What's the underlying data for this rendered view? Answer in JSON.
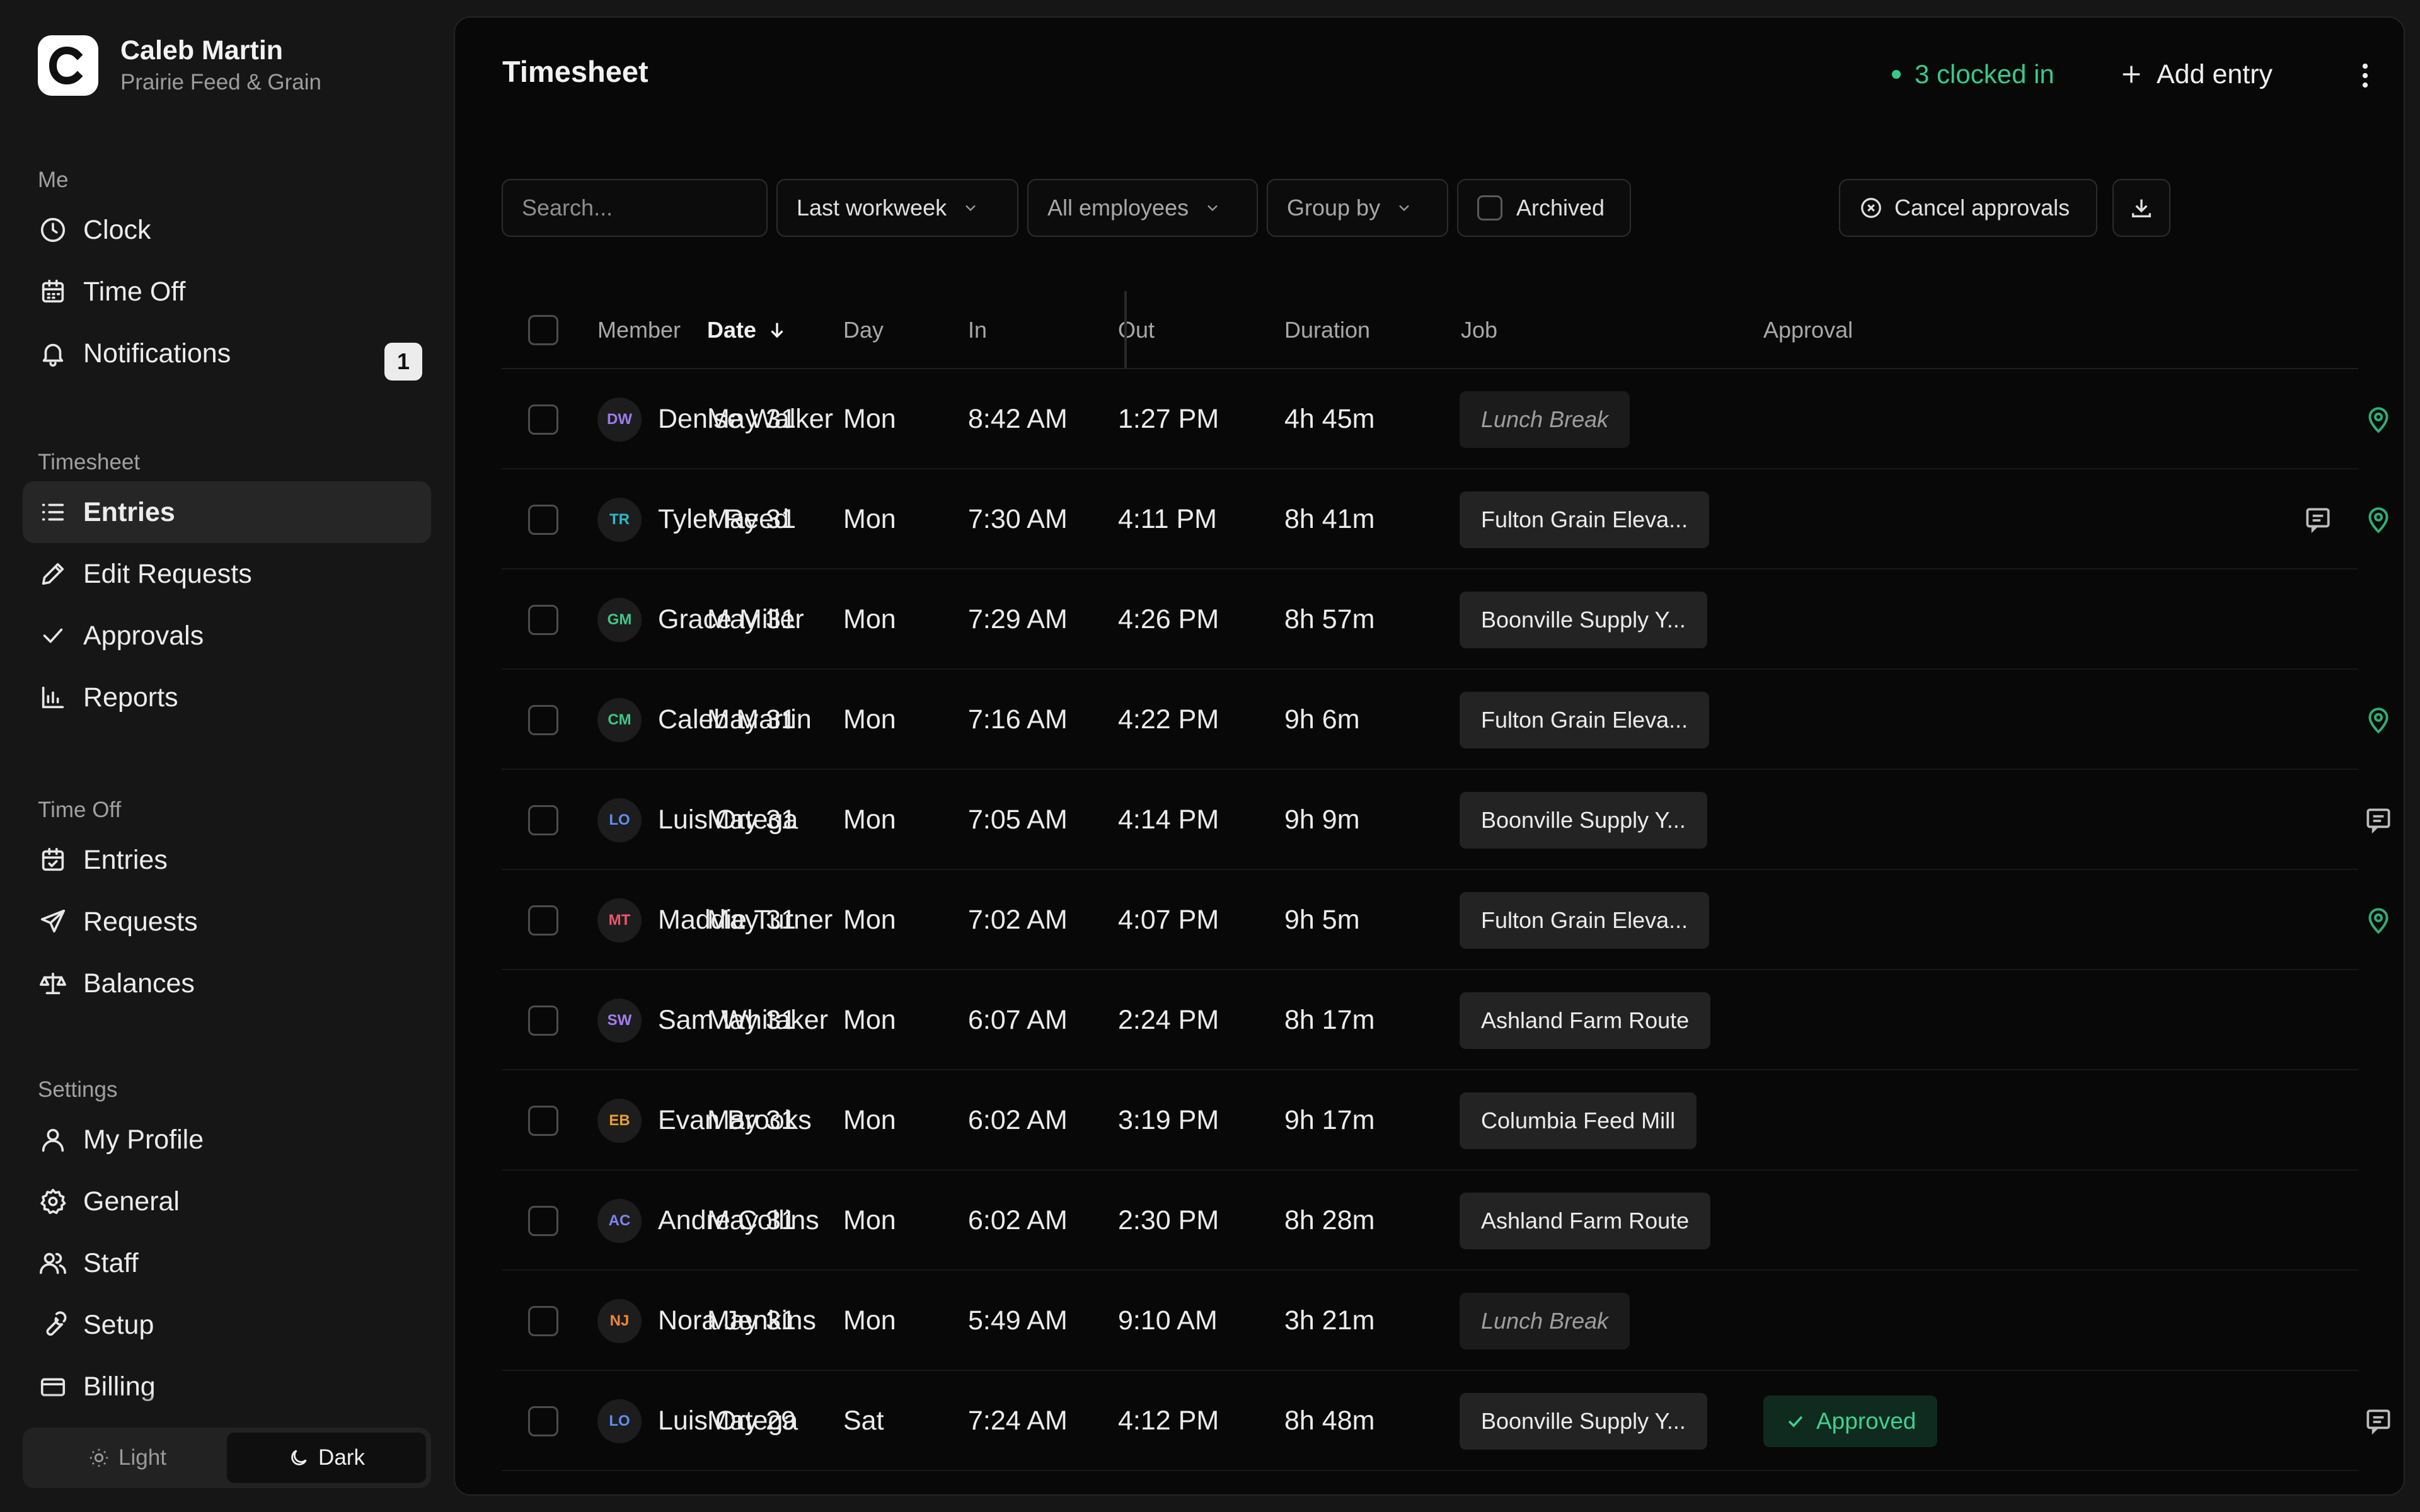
{
  "org": {
    "initial": "C",
    "name": "Caleb Martin",
    "company": "Prairie Feed & Grain"
  },
  "sidebar": {
    "sections": [
      {
        "heading": "Me",
        "items": [
          {
            "label": "Clock",
            "icon": "clock-icon"
          },
          {
            "label": "Time Off",
            "icon": "calendar-icon"
          },
          {
            "label": "Notifications",
            "icon": "bell-icon",
            "badge": "1"
          }
        ]
      },
      {
        "heading": "Timesheet",
        "items": [
          {
            "label": "Entries",
            "icon": "list-icon",
            "active": true
          },
          {
            "label": "Edit Requests",
            "icon": "pencil-icon"
          },
          {
            "label": "Approvals",
            "icon": "check-icon"
          },
          {
            "label": "Reports",
            "icon": "bar-chart-icon"
          }
        ]
      },
      {
        "heading": "Time Off",
        "items": [
          {
            "label": "Entries",
            "icon": "calendar-check-icon"
          },
          {
            "label": "Requests",
            "icon": "send-icon"
          },
          {
            "label": "Balances",
            "icon": "scale-icon"
          }
        ]
      },
      {
        "heading": "Settings",
        "items": [
          {
            "label": "My Profile",
            "icon": "user-icon"
          },
          {
            "label": "General",
            "icon": "gear-icon"
          },
          {
            "label": "Staff",
            "icon": "users-icon"
          },
          {
            "label": "Setup",
            "icon": "wrench-icon"
          },
          {
            "label": "Billing",
            "icon": "card-icon"
          }
        ]
      }
    ],
    "theme": {
      "light": "Light",
      "dark": "Dark",
      "selected": "dark"
    }
  },
  "header": {
    "title": "Timesheet",
    "clocked_in": "3 clocked in",
    "add_entry": "Add entry"
  },
  "filters": {
    "search_placeholder": "Search...",
    "range": "Last workweek",
    "employees": "All employees",
    "group_by": "Group by",
    "archived": "Archived",
    "cancel_approvals": "Cancel approvals"
  },
  "table": {
    "columns": {
      "member": "Member",
      "date": "Date",
      "day": "Day",
      "in": "In",
      "out": "Out",
      "duration": "Duration",
      "job": "Job",
      "approval": "Approval"
    },
    "rows": [
      {
        "initials": "DW",
        "color": "#9b7bf0",
        "member": "Denise Walker",
        "date": "May 31",
        "day": "Mon",
        "in": "8:42 AM",
        "out": "1:27 PM",
        "duration": "4h 45m",
        "job": "Lunch Break",
        "job_muted": true,
        "approval": "",
        "note": false,
        "location": true
      },
      {
        "initials": "TR",
        "color": "#2fb8c9",
        "member": "Tyler Reed",
        "date": "May 31",
        "day": "Mon",
        "in": "7:30 AM",
        "out": "4:11 PM",
        "duration": "8h 41m",
        "job": "Fulton Grain Eleva...",
        "job_muted": false,
        "approval": "",
        "note": true,
        "location": true
      },
      {
        "initials": "GM",
        "color": "#3ec787",
        "member": "Grace Miller",
        "date": "May 31",
        "day": "Mon",
        "in": "7:29 AM",
        "out": "4:26 PM",
        "duration": "8h 57m",
        "job": "Boonville Supply Y...",
        "job_muted": false,
        "approval": "",
        "note": false,
        "location": false
      },
      {
        "initials": "CM",
        "color": "#3ec787",
        "member": "Caleb Martin",
        "date": "May 31",
        "day": "Mon",
        "in": "7:16 AM",
        "out": "4:22 PM",
        "duration": "9h 6m",
        "job": "Fulton Grain Eleva...",
        "job_muted": false,
        "approval": "",
        "note": false,
        "location": true
      },
      {
        "initials": "LO",
        "color": "#5c8ff0",
        "member": "Luis Ortega",
        "date": "May 31",
        "day": "Mon",
        "in": "7:05 AM",
        "out": "4:14 PM",
        "duration": "9h 9m",
        "job": "Boonville Supply Y...",
        "job_muted": false,
        "approval": "",
        "note": true,
        "location": false
      },
      {
        "initials": "MT",
        "color": "#e9586a",
        "member": "Maddie Turner",
        "date": "May 31",
        "day": "Mon",
        "in": "7:02 AM",
        "out": "4:07 PM",
        "duration": "9h 5m",
        "job": "Fulton Grain Eleva...",
        "job_muted": false,
        "approval": "",
        "note": false,
        "location": true
      },
      {
        "initials": "SW",
        "color": "#a47ef0",
        "member": "Sam Whitaker",
        "date": "May 31",
        "day": "Mon",
        "in": "6:07 AM",
        "out": "2:24 PM",
        "duration": "8h 17m",
        "job": "Ashland Farm Route",
        "job_muted": false,
        "approval": "",
        "note": false,
        "location": false
      },
      {
        "initials": "EB",
        "color": "#e6a030",
        "member": "Evan Brooks",
        "date": "May 31",
        "day": "Mon",
        "in": "6:02 AM",
        "out": "3:19 PM",
        "duration": "9h 17m",
        "job": "Columbia Feed Mill",
        "job_muted": false,
        "approval": "",
        "note": false,
        "location": false
      },
      {
        "initials": "AC",
        "color": "#7f86f0",
        "member": "Andre Collins",
        "date": "May 31",
        "day": "Mon",
        "in": "6:02 AM",
        "out": "2:30 PM",
        "duration": "8h 28m",
        "job": "Ashland Farm Route",
        "job_muted": false,
        "approval": "",
        "note": false,
        "location": false
      },
      {
        "initials": "NJ",
        "color": "#ef8838",
        "member": "Nora Jenkins",
        "date": "May 31",
        "day": "Mon",
        "in": "5:49 AM",
        "out": "9:10 AM",
        "duration": "3h 21m",
        "job": "Lunch Break",
        "job_muted": true,
        "approval": "",
        "note": false,
        "location": false
      },
      {
        "initials": "LO",
        "color": "#5c8ff0",
        "member": "Luis Ortega",
        "date": "May 29",
        "day": "Sat",
        "in": "7:24 AM",
        "out": "4:12 PM",
        "duration": "8h 48m",
        "job": "Boonville Supply Y...",
        "job_muted": false,
        "approval": "Approved",
        "note": true,
        "location": false
      }
    ]
  },
  "colors": {
    "accent_green": "#36c98a",
    "location_green": "#2fae78",
    "panel": "#080808"
  }
}
